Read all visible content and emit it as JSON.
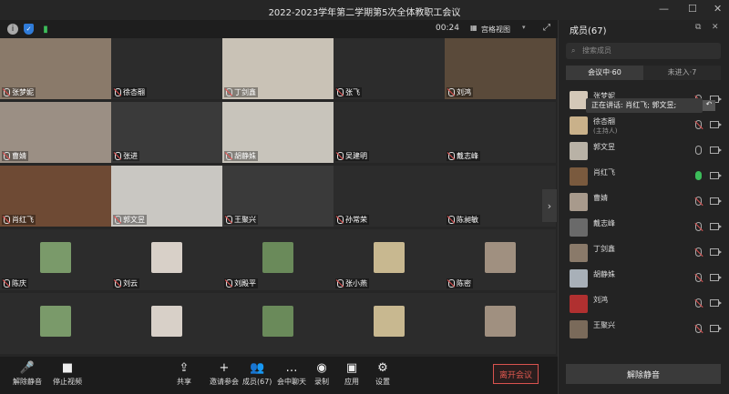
{
  "window": {
    "title": "2022-2023学年第二学期第5次全体教职工会议"
  },
  "topbar": {
    "timer": "00:24",
    "view_label": "宫格视图"
  },
  "tiles": [
    {
      "name": "张梦妮",
      "bg": "#8a7a6a"
    },
    {
      "name": "徐杏翮",
      "bg": "#2c2c2c"
    },
    {
      "name": "丁剑鑫",
      "bg": "#c9c2b6"
    },
    {
      "name": "张飞",
      "bg": "#2c2c2c"
    },
    {
      "name": "刘鸿",
      "bg": "#5a4a3a"
    },
    {
      "name": "曹婧",
      "bg": "#9b8f84"
    },
    {
      "name": "张进",
      "bg": "#3a3a3a"
    },
    {
      "name": "胡静姝",
      "bg": "#c8c4bb"
    },
    {
      "name": "吴建明",
      "bg": "#2c2c2c"
    },
    {
      "name": "戴志峰",
      "bg": "#2c2c2c"
    },
    {
      "name": "肖红飞",
      "bg": "#6e4a34"
    },
    {
      "name": "郭文昱",
      "bg": "#c9c7c2"
    },
    {
      "name": "王聚兴",
      "bg": "#3a3a3a"
    },
    {
      "name": "孙常荣",
      "bg": "#2c2c2c"
    },
    {
      "name": "陈昶敏",
      "bg": "#2c2c2c"
    },
    {
      "name": "陈庆",
      "bg": "#2c2c2c"
    },
    {
      "name": "刘云",
      "bg": "#2c2c2c"
    },
    {
      "name": "刘殿平",
      "bg": "#2c2c2c"
    },
    {
      "name": "张小燕",
      "bg": "#2c2c2c"
    },
    {
      "name": "陈密",
      "bg": "#2c2c2c"
    },
    {
      "name": "",
      "bg": "#2c2c2c"
    },
    {
      "name": "",
      "bg": "#2c2c2c"
    },
    {
      "name": "",
      "bg": "#2c2c2c"
    },
    {
      "name": "",
      "bg": "#2c2c2c"
    },
    {
      "name": "",
      "bg": "#2c2c2c"
    }
  ],
  "toolbar": {
    "unmute": "解除静音",
    "stop_video": "停止视频",
    "share": "共享",
    "invite": "邀请参会",
    "members": "成员(67)",
    "chat": "会中聊天",
    "record": "录制",
    "apps": "应用",
    "settings": "设置",
    "leave": "离开会议"
  },
  "panel": {
    "title": "成员(67)",
    "search_placeholder": "搜索成员",
    "tab_in": "会议中·60",
    "tab_out": "未进入·7",
    "speaking": "正在讲话: 肖红飞; 郭文昱;",
    "members": [
      {
        "name": "张梦妮",
        "sub": "",
        "mic": "slash",
        "color": "#d4c8b8"
      },
      {
        "name": "徐杏翮",
        "sub": "(主持人)",
        "mic": "slash",
        "color": "#c9b18a"
      },
      {
        "name": "郭文昱",
        "sub": "",
        "mic": "plain",
        "color": "#b9b2a6"
      },
      {
        "name": "肖红飞",
        "sub": "",
        "mic": "on",
        "color": "#7a5a3e"
      },
      {
        "name": "曹婧",
        "sub": "",
        "mic": "slash",
        "color": "#a89a8c"
      },
      {
        "name": "戴志峰",
        "sub": "",
        "mic": "slash",
        "color": "#6a6a6a"
      },
      {
        "name": "丁剑鑫",
        "sub": "",
        "mic": "slash",
        "color": "#8a7a6a"
      },
      {
        "name": "胡静姝",
        "sub": "",
        "mic": "slash",
        "color": "#a8b0b8"
      },
      {
        "name": "刘鸿",
        "sub": "",
        "mic": "slash",
        "color": "#b03030"
      },
      {
        "name": "王聚兴",
        "sub": "",
        "mic": "slash",
        "color": "#7a6a5a"
      }
    ],
    "unmute_all": "解除静音"
  }
}
